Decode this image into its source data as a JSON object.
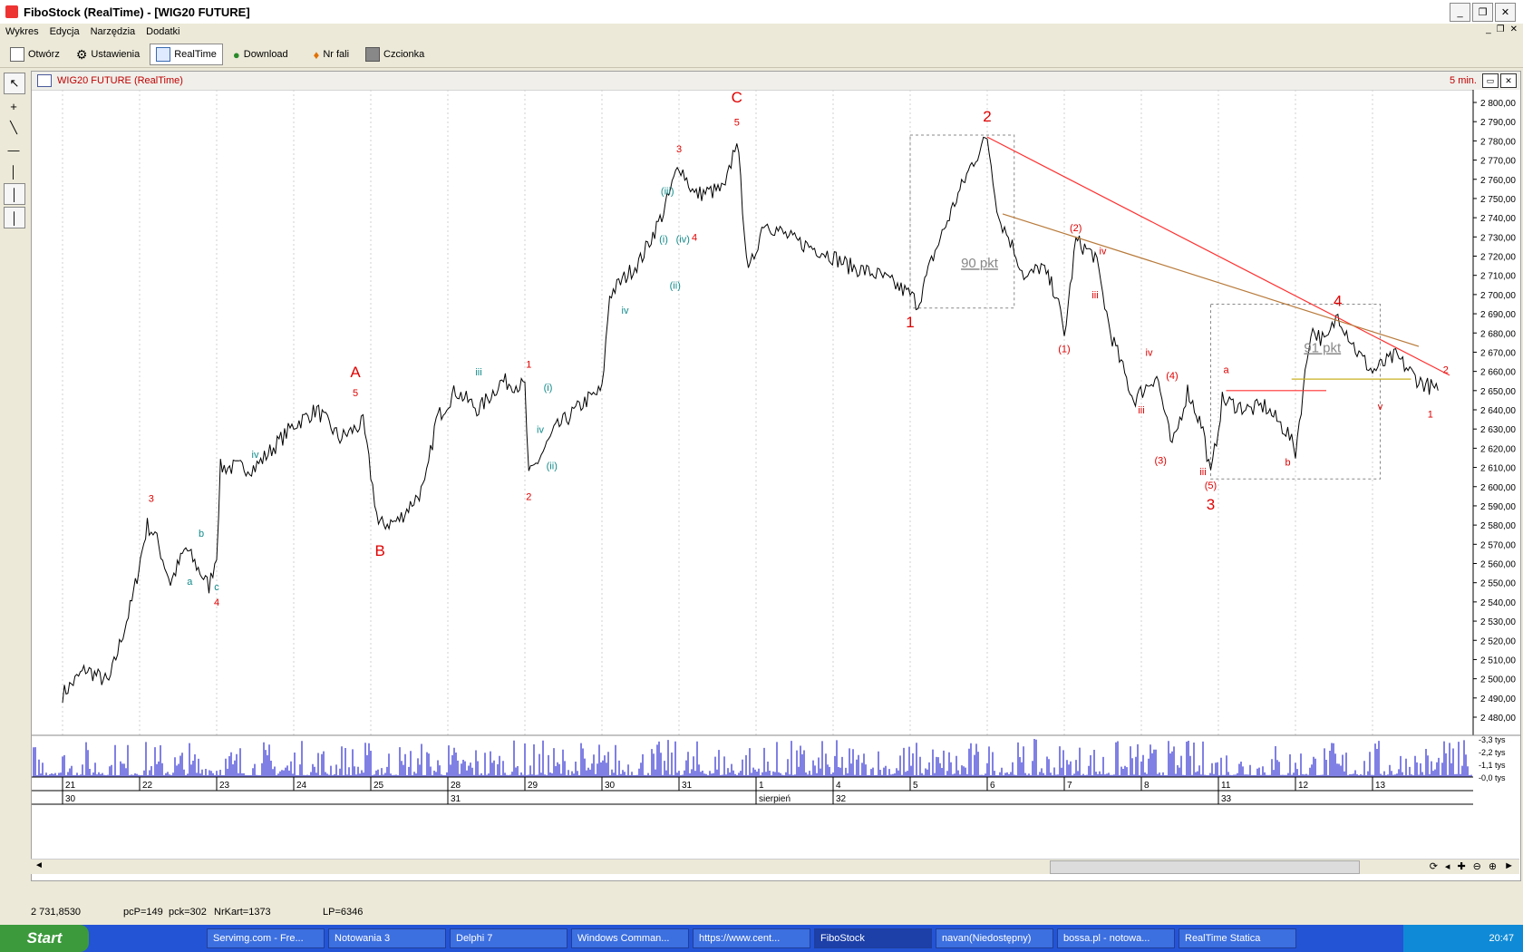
{
  "window": {
    "title": "FiboStock (RealTime) - [WIG20 FUTURE]"
  },
  "menu": [
    "Wykres",
    "Edycja",
    "Narzędzia",
    "Dodatki"
  ],
  "toolbar": {
    "open": "Otwórz",
    "settings": "Ustawienia",
    "realtime": "RealTime",
    "download": "Download",
    "wave_no": "Nr fali",
    "font": "Czcionka"
  },
  "chart": {
    "title": "WIG20 FUTURE (RealTime)",
    "interval": "5 min."
  },
  "chart_data": {
    "type": "line",
    "y_ticks": [
      "2 800,00",
      "2 790,00",
      "2 780,00",
      "2 770,00",
      "2 760,00",
      "2 750,00",
      "2 740,00",
      "2 730,00",
      "2 720,00",
      "2 710,00",
      "2 700,00",
      "2 690,00",
      "2 680,00",
      "2 670,00",
      "2 660,00",
      "2 650,00",
      "2 640,00",
      "2 630,00",
      "2 620,00",
      "2 610,00",
      "2 600,00",
      "2 590,00",
      "2 580,00",
      "2 570,00",
      "2 560,00",
      "2 550,00",
      "2 540,00",
      "2 530,00",
      "2 520,00",
      "2 510,00",
      "2 500,00",
      "2 490,00",
      "2 480,00"
    ],
    "volume_ticks": [
      "-3,3 tys",
      "-2,2 tys",
      "-1,1 tys",
      "-0,0 tys"
    ],
    "x_days": [
      "21",
      "22",
      "23",
      "24",
      "25",
      "28",
      "29",
      "30",
      "31",
      "1",
      "4",
      "5",
      "6",
      "7",
      "8",
      "11",
      "12",
      "13"
    ],
    "x_weeks": [
      {
        "label": "30",
        "day_index": 0
      },
      {
        "label": "31",
        "day_index": 5
      },
      {
        "label": "sierpień",
        "day_index": 9
      },
      {
        "label": "32",
        "day_index": 10
      },
      {
        "label": "33",
        "day_index": 15
      }
    ],
    "price_path": [
      [
        0,
        2492
      ],
      [
        0.3,
        2505
      ],
      [
        0.6,
        2498
      ],
      [
        0.9,
        2540
      ],
      [
        1.1,
        2580
      ],
      [
        1.2,
        2575
      ],
      [
        1.4,
        2550
      ],
      [
        1.6,
        2568
      ],
      [
        1.9,
        2548
      ],
      [
        2.0,
        2565
      ],
      [
        2.05,
        2610
      ],
      [
        2.5,
        2610
      ],
      [
        3.0,
        2632
      ],
      [
        3.3,
        2640
      ],
      [
        3.6,
        2625
      ],
      [
        3.9,
        2633
      ],
      [
        4.1,
        2580
      ],
      [
        4.35,
        2582
      ],
      [
        4.7,
        2600
      ],
      [
        4.85,
        2635
      ],
      [
        5.1,
        2650
      ],
      [
        5.4,
        2640
      ],
      [
        5.7,
        2655
      ],
      [
        6.0,
        2652
      ],
      [
        6.05,
        2605
      ],
      [
        6.4,
        2630
      ],
      [
        6.8,
        2645
      ],
      [
        7.0,
        2650
      ],
      [
        7.1,
        2700
      ],
      [
        7.5,
        2718
      ],
      [
        7.8,
        2743
      ],
      [
        8.0,
        2768
      ],
      [
        8.2,
        2752
      ],
      [
        8.6,
        2755
      ],
      [
        8.75,
        2782
      ],
      [
        8.9,
        2710
      ],
      [
        9.1,
        2738
      ],
      [
        9.5,
        2728
      ],
      [
        9.9,
        2722
      ],
      [
        10.2,
        2715
      ],
      [
        10.6,
        2710
      ],
      [
        11.0,
        2700
      ],
      [
        11.1,
        2695
      ],
      [
        11.3,
        2720
      ],
      [
        11.6,
        2750
      ],
      [
        11.8,
        2768
      ],
      [
        12.0,
        2782
      ],
      [
        12.15,
        2740
      ],
      [
        12.3,
        2728
      ],
      [
        12.5,
        2708
      ],
      [
        12.7,
        2715
      ],
      [
        12.9,
        2700
      ],
      [
        13.0,
        2678
      ],
      [
        13.15,
        2728
      ],
      [
        13.4,
        2720
      ],
      [
        13.6,
        2680
      ],
      [
        13.9,
        2645
      ],
      [
        14.2,
        2658
      ],
      [
        14.4,
        2620
      ],
      [
        14.6,
        2650
      ],
      [
        14.8,
        2630
      ],
      [
        14.9,
        2605
      ],
      [
        15.05,
        2645
      ],
      [
        15.4,
        2640
      ],
      [
        15.6,
        2642
      ],
      [
        15.9,
        2628
      ],
      [
        16.0,
        2618
      ],
      [
        16.2,
        2682
      ],
      [
        16.4,
        2675
      ],
      [
        16.55,
        2690
      ],
      [
        16.8,
        2670
      ],
      [
        17.0,
        2660
      ],
      [
        17.3,
        2668
      ],
      [
        17.6,
        2655
      ],
      [
        17.85,
        2650
      ]
    ],
    "wave_labels": [
      {
        "t": "A",
        "d": 3.8,
        "p": 2657,
        "c": "red",
        "s": "big"
      },
      {
        "t": "B",
        "d": 4.12,
        "p": 2564,
        "c": "red",
        "s": "big"
      },
      {
        "t": "C",
        "d": 8.75,
        "p": 2800,
        "c": "red",
        "s": "big"
      },
      {
        "t": "1",
        "d": 11.0,
        "p": 2683,
        "c": "red",
        "s": "big"
      },
      {
        "t": "2",
        "d": 12.0,
        "p": 2790,
        "c": "red",
        "s": "big"
      },
      {
        "t": "3",
        "d": 14.9,
        "p": 2588,
        "c": "red",
        "s": "big"
      },
      {
        "t": "4",
        "d": 16.55,
        "p": 2694,
        "c": "red",
        "s": "big"
      },
      {
        "t": "5",
        "d": 3.8,
        "p": 2647,
        "c": "red",
        "s": "sm"
      },
      {
        "t": "5",
        "d": 8.75,
        "p": 2788,
        "c": "red",
        "s": "sm"
      },
      {
        "t": "3",
        "d": 1.15,
        "p": 2592,
        "c": "red",
        "s": "sm"
      },
      {
        "t": "4",
        "d": 2.0,
        "p": 2538,
        "c": "red",
        "s": "sm"
      },
      {
        "t": "1",
        "d": 6.05,
        "p": 2662,
        "c": "red",
        "s": "sm"
      },
      {
        "t": "2",
        "d": 6.05,
        "p": 2593,
        "c": "red",
        "s": "sm"
      },
      {
        "t": "3",
        "d": 8.0,
        "p": 2774,
        "c": "red",
        "s": "sm"
      },
      {
        "t": "4",
        "d": 8.2,
        "p": 2728,
        "c": "red",
        "s": "sm"
      },
      {
        "t": "(1)",
        "d": 13.0,
        "p": 2670,
        "c": "red",
        "s": "sm"
      },
      {
        "t": "(2)",
        "d": 13.15,
        "p": 2733,
        "c": "red",
        "s": "sm"
      },
      {
        "t": "(3)",
        "d": 14.25,
        "p": 2612,
        "c": "red",
        "s": "sm"
      },
      {
        "t": "(4)",
        "d": 14.4,
        "p": 2656,
        "c": "red",
        "s": "sm"
      },
      {
        "t": "(5)",
        "d": 14.9,
        "p": 2599,
        "c": "red",
        "s": "sm"
      },
      {
        "t": "a",
        "d": 1.65,
        "p": 2549,
        "c": "teal",
        "s": "sm"
      },
      {
        "t": "b",
        "d": 1.8,
        "p": 2574,
        "c": "teal",
        "s": "sm"
      },
      {
        "t": "c",
        "d": 2.0,
        "p": 2546,
        "c": "teal",
        "s": "sm"
      },
      {
        "t": "iv",
        "d": 2.5,
        "p": 2615,
        "c": "teal",
        "s": "sm"
      },
      {
        "t": "iii",
        "d": 5.4,
        "p": 2658,
        "c": "teal",
        "s": "sm"
      },
      {
        "t": "iv",
        "d": 6.2,
        "p": 2628,
        "c": "teal",
        "s": "sm"
      },
      {
        "t": "(i)",
        "d": 6.3,
        "p": 2650,
        "c": "teal",
        "s": "sm"
      },
      {
        "t": "(ii)",
        "d": 6.35,
        "p": 2609,
        "c": "teal",
        "s": "sm"
      },
      {
        "t": "(i)",
        "d": 7.8,
        "p": 2727,
        "c": "teal",
        "s": "sm"
      },
      {
        "t": "(ii)",
        "d": 7.95,
        "p": 2703,
        "c": "teal",
        "s": "sm"
      },
      {
        "t": "(iii)",
        "d": 7.85,
        "p": 2752,
        "c": "teal",
        "s": "sm"
      },
      {
        "t": "(iv)",
        "d": 8.05,
        "p": 2727,
        "c": "teal",
        "s": "sm"
      },
      {
        "t": "iv",
        "d": 7.3,
        "p": 2690,
        "c": "teal",
        "s": "sm"
      },
      {
        "t": "a",
        "d": 15.1,
        "p": 2659,
        "c": "red",
        "s": "sm"
      },
      {
        "t": "b",
        "d": 15.9,
        "p": 2611,
        "c": "red",
        "s": "sm"
      },
      {
        "t": "iv",
        "d": 13.5,
        "p": 2721,
        "c": "red",
        "s": "sm"
      },
      {
        "t": "iii",
        "d": 13.4,
        "p": 2698,
        "c": "red",
        "s": "sm"
      },
      {
        "t": "iv",
        "d": 14.1,
        "p": 2668,
        "c": "red",
        "s": "sm"
      },
      {
        "t": "iii",
        "d": 14.0,
        "p": 2638,
        "c": "red",
        "s": "sm"
      },
      {
        "t": "iii",
        "d": 14.8,
        "p": 2606,
        "c": "red",
        "s": "sm"
      },
      {
        "t": "v",
        "d": 17.1,
        "p": 2640,
        "c": "red",
        "s": "sm"
      },
      {
        "t": "1",
        "d": 17.75,
        "p": 2636,
        "c": "red",
        "s": "sm"
      },
      {
        "t": "2",
        "d": 17.95,
        "p": 2659,
        "c": "red",
        "s": "sm"
      }
    ],
    "annotations": [
      {
        "text": "90 pkt",
        "d": 11.9,
        "p": 2714
      },
      {
        "text": "91 pkt",
        "d": 16.35,
        "p": 2670
      }
    ],
    "trendlines": [
      {
        "from": [
          12.0,
          2782
        ],
        "to": [
          18.0,
          2658
        ],
        "color": "#ff3030"
      },
      {
        "from": [
          12.2,
          2742
        ],
        "to": [
          17.6,
          2673
        ],
        "color": "#b87a3a"
      },
      {
        "from": [
          15.95,
          2656
        ],
        "to": [
          17.5,
          2656
        ],
        "color": "#c8b020"
      },
      {
        "from": [
          15.1,
          2650
        ],
        "to": [
          16.4,
          2650
        ],
        "color": "#ff3030"
      }
    ],
    "boxes": [
      {
        "d0": 11.0,
        "d1": 12.35,
        "p0": 2693,
        "p1": 2783
      },
      {
        "d0": 14.9,
        "d1": 17.1,
        "p0": 2604,
        "p1": 2695
      }
    ]
  },
  "status": {
    "price": "2 731,8530",
    "pcp": "pcP=149",
    "pck": "pck=302",
    "nrkart": "NrKart=1373",
    "lp": "LP=6346"
  },
  "taskbar": {
    "start": "Start",
    "tasks": [
      "Servimg.com - Fre...",
      "Notowania 3",
      "Delphi 7",
      "Windows Comman...",
      "https://www.cent...",
      "FiboStock",
      "navan(Niedostępny)",
      "bossa.pl - notowa...",
      "RealTime Statica"
    ],
    "clock": "20:47"
  }
}
